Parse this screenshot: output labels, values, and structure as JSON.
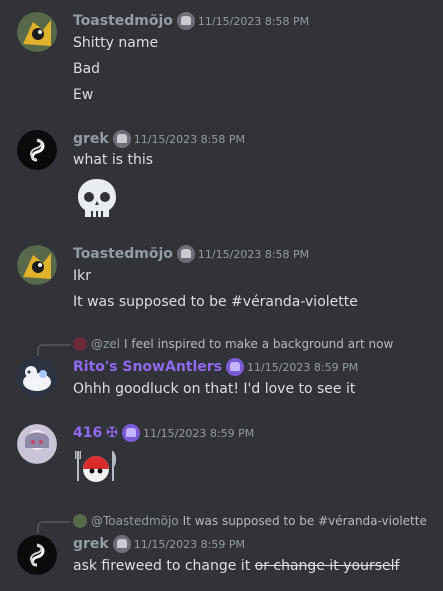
{
  "messages": [
    {
      "author": "Toastedmöjo",
      "timestamp": "11/15/2023 8:58 PM",
      "lines": [
        "Shitty name",
        "Bad",
        "Ew"
      ]
    },
    {
      "author": "grek",
      "timestamp": "11/15/2023 8:58 PM",
      "lines": [
        "what is this"
      ]
    },
    {
      "author": "Toastedmöjo",
      "timestamp": "11/15/2023 8:58 PM",
      "lines": [
        "Ikr",
        "It was supposed to be #véranda-violette"
      ]
    },
    {
      "author": "Rito's SnowAntlers",
      "timestamp": "11/15/2023 8:59 PM",
      "reply_to": "@zel",
      "reply_text": "I feel inspired to make a background art now",
      "lines": [
        "Ohhh goodluck on that! I'd love to see it"
      ]
    },
    {
      "author": "416",
      "author_suffix": "✠",
      "timestamp": "11/15/2023 8:59 PM",
      "lines": []
    },
    {
      "author": "grek",
      "timestamp": "11/15/2023 8:59 PM",
      "reply_to": "@Toastedmöjo",
      "reply_text": "It was supposed to be #véranda-violette",
      "text_main": "ask fireweed to change it",
      "text_strike": "or change it yourself"
    }
  ],
  "icons": {
    "skull": "skull-emoji",
    "fork": "fork-and-knife-emoji",
    "badge": "role-badge-icon"
  },
  "colors": {
    "background": "#313338",
    "name_default": "#949ba4",
    "name_purple": "#8d6bf0",
    "text": "#dbdee1"
  }
}
